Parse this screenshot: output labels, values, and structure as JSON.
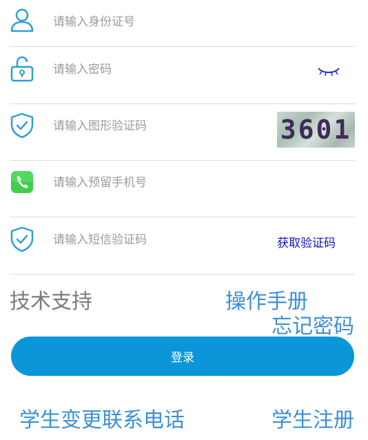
{
  "form": {
    "id_number_placeholder": "请输入身份证号",
    "password_placeholder": "请输入密码",
    "captcha_placeholder": "请输入图形验证码",
    "captcha_image_text": "3601",
    "phone_placeholder": "请输入预留手机号",
    "sms_code_placeholder": "请输入短信验证码",
    "get_code_label": "获取验证码"
  },
  "links": {
    "tech_support": "技术支持",
    "manual": "操作手册",
    "forgot_password": "忘记密码",
    "change_phone": "学生变更联系电话",
    "register": "学生注册"
  },
  "buttons": {
    "login_label": "登录"
  },
  "colors": {
    "accent_blue": "#0b96d9",
    "link_blue": "#3b8fd6",
    "icon_blue": "#2a9fd8",
    "get_code_blue": "#1212c8"
  }
}
